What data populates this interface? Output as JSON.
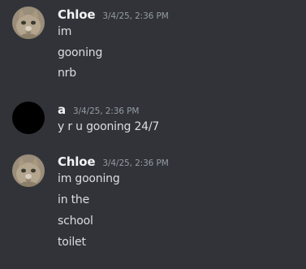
{
  "messages": [
    {
      "author": "Chloe",
      "timestamp": "3/4/25, 2:36 PM",
      "avatar_icon": "cat-avatar",
      "lines": [
        "im",
        "gooning",
        "nrb"
      ]
    },
    {
      "author": "a",
      "timestamp": "3/4/25, 2:36 PM",
      "avatar_icon": "black-circle-avatar",
      "lines": [
        "y r u gooning 24/7"
      ]
    },
    {
      "author": "Chloe",
      "timestamp": "3/4/25, 2:36 PM",
      "avatar_icon": "cat-avatar",
      "lines": [
        "im gooning",
        "in the",
        "school",
        "toilet"
      ]
    }
  ],
  "colors": {
    "background": "#313338",
    "username": "#f2f3f5",
    "text": "#dbdee1",
    "timestamp": "#949ba4"
  }
}
